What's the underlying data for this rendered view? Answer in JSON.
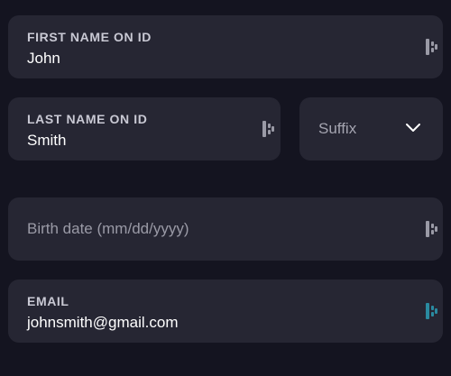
{
  "form": {
    "first_name": {
      "label": "FIRST NAME ON ID",
      "value": "John",
      "icon": "password-manager-icon"
    },
    "last_name": {
      "label": "LAST NAME ON ID",
      "value": "Smith",
      "icon": "password-manager-icon"
    },
    "suffix": {
      "selected": "Suffix",
      "icon": "chevron-down-icon"
    },
    "birth_date": {
      "placeholder": "Birth date (mm/dd/yyyy)",
      "icon": "password-manager-icon"
    },
    "email": {
      "label": "EMAIL",
      "value": "johnsmith@gmail.com",
      "icon": "password-manager-icon"
    }
  },
  "colors": {
    "background": "#141420",
    "field": "#262633",
    "icon_default": "#9a9aa6",
    "icon_active": "#2a8aa0"
  }
}
